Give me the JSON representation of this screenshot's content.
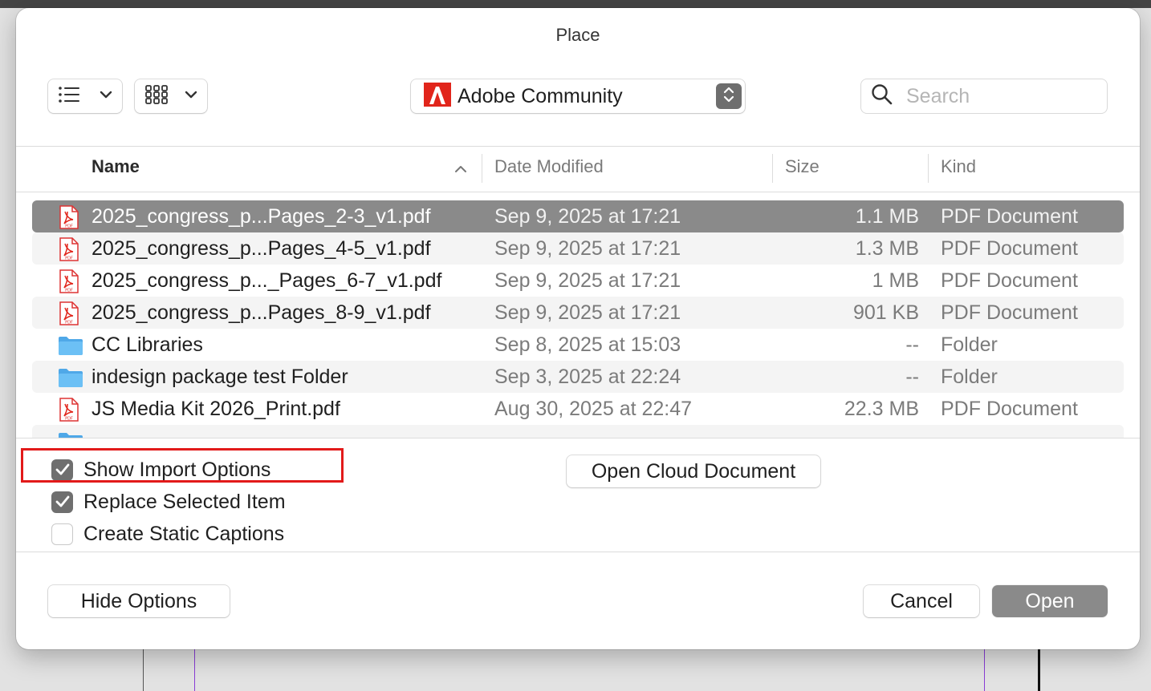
{
  "dialog": {
    "title": "Place"
  },
  "toolbar": {
    "list_view_icon": "list-view-icon",
    "grid_view_icon": "grid-view-icon",
    "location": "Adobe Community",
    "location_icon": "adobe-logo-icon",
    "search_placeholder": "Search",
    "search_value": ""
  },
  "columns": {
    "name": "Name",
    "date": "Date Modified",
    "size": "Size",
    "kind": "Kind",
    "sort": "ascending by Name"
  },
  "files": [
    {
      "name": "2025_congress_p...Pages_2-3_v1.pdf",
      "date": "Sep 9, 2025 at 17:21",
      "size": "1.1 MB",
      "kind": "PDF Document",
      "icon": "pdf-icon",
      "selected": true
    },
    {
      "name": "2025_congress_p...Pages_4-5_v1.pdf",
      "date": "Sep 9, 2025 at 17:21",
      "size": "1.3 MB",
      "kind": "PDF Document",
      "icon": "pdf-icon"
    },
    {
      "name": "2025_congress_p..._Pages_6-7_v1.pdf",
      "date": "Sep 9, 2025 at 17:21",
      "size": "1 MB",
      "kind": "PDF Document",
      "icon": "pdf-icon"
    },
    {
      "name": "2025_congress_p...Pages_8-9_v1.pdf",
      "date": "Sep 9, 2025 at 17:21",
      "size": "901 KB",
      "kind": "PDF Document",
      "icon": "pdf-icon"
    },
    {
      "name": "CC Libraries",
      "date": "Sep 8, 2025 at 15:03",
      "size": "--",
      "kind": "Folder",
      "icon": "folder-icon"
    },
    {
      "name": "indesign package test Folder",
      "date": "Sep 3, 2025 at 22:24",
      "size": "--",
      "kind": "Folder",
      "icon": "folder-icon"
    },
    {
      "name": "JS Media Kit 2026_Print.pdf",
      "date": "Aug 30, 2025 at 22:47",
      "size": "22.3 MB",
      "kind": "PDF Document",
      "icon": "pdf-icon"
    }
  ],
  "options": {
    "show_import": {
      "label": "Show Import Options",
      "checked": true
    },
    "replace_selected": {
      "label": "Replace Selected Item",
      "checked": true
    },
    "static_captions": {
      "label": "Create Static Captions",
      "checked": false
    },
    "open_cloud": "Open Cloud Document"
  },
  "footer": {
    "hide_options": "Hide Options",
    "cancel": "Cancel",
    "open": "Open"
  },
  "colors": {
    "selection": "#8a8a8a",
    "highlight": "#e21a1a",
    "adobe_red": "#e1251b",
    "folder_blue": "#5bb8f0"
  }
}
